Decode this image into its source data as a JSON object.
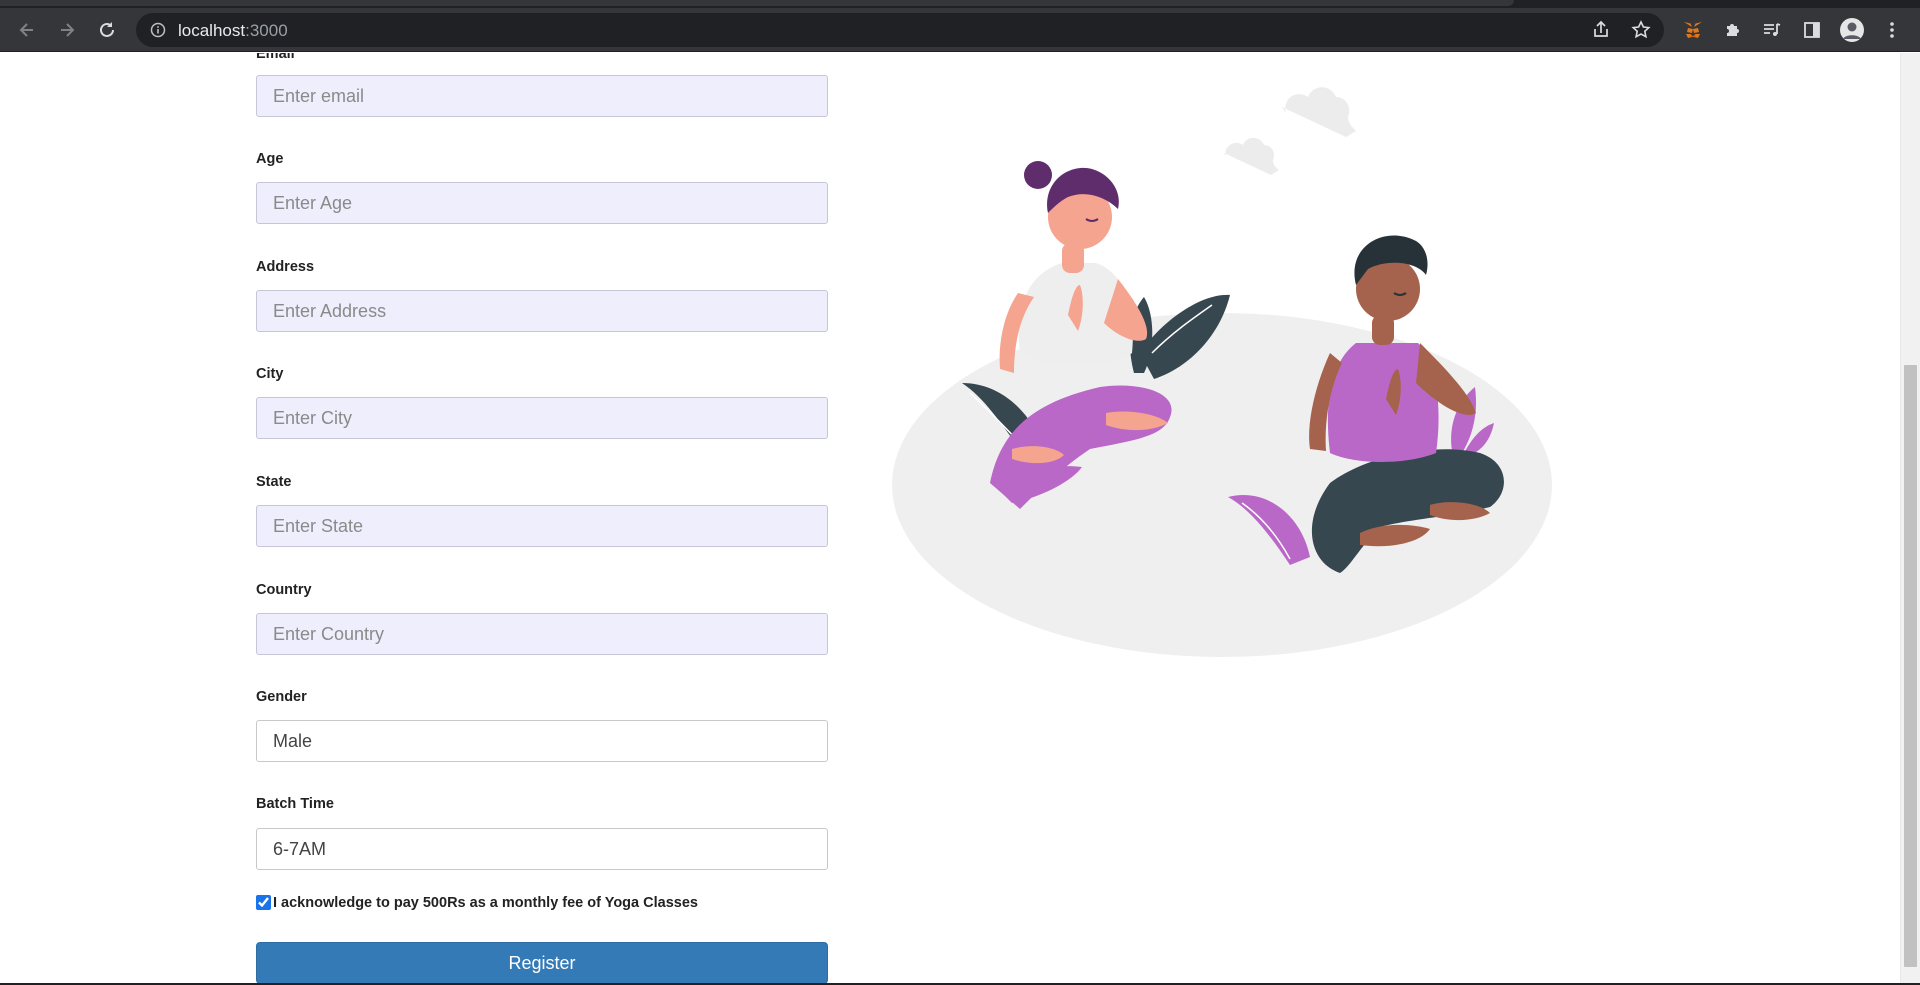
{
  "browser": {
    "url_host": "localhost",
    "url_port": ":3000"
  },
  "form": {
    "fields": [
      {
        "label": "Email",
        "placeholder": "Enter email",
        "value": ""
      },
      {
        "label": "Age",
        "placeholder": "Enter Age",
        "value": ""
      },
      {
        "label": "Address",
        "placeholder": "Enter Address",
        "value": ""
      },
      {
        "label": "City",
        "placeholder": "Enter City",
        "value": ""
      },
      {
        "label": "State",
        "placeholder": "Enter State",
        "value": ""
      },
      {
        "label": "Country",
        "placeholder": "Enter Country",
        "value": ""
      }
    ],
    "gender": {
      "label": "Gender",
      "value": "Male"
    },
    "batch_time": {
      "label": "Batch Time",
      "value": "6-7AM"
    },
    "acknowledge": {
      "checked": true,
      "text": "I acknowledge to pay 500Rs as a monthly fee of Yoga Classes"
    },
    "register_label": "Register"
  },
  "colors": {
    "button": "#337ab7",
    "input_bg": "#eeeefd",
    "chrome": "#35363a"
  }
}
